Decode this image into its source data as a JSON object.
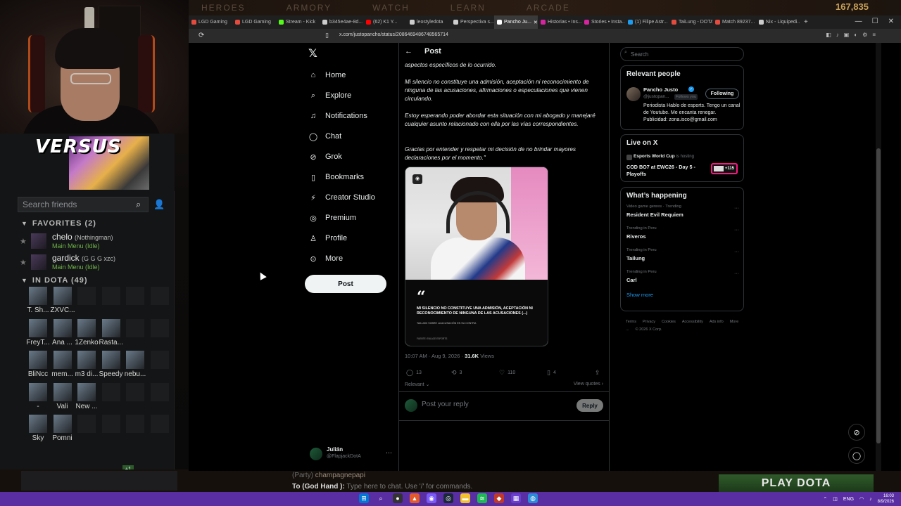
{
  "game": {
    "top_menu": [
      "HEROES",
      "ARMORY",
      "WATCH",
      "LEARN",
      "ARCADE"
    ],
    "gold": "167,835",
    "play_button": "PLAY DOTA",
    "party_prefix": "(Party)",
    "party_name": "champagnepapi",
    "chat_to": "To (God Hand ):",
    "chat_placeholder": "Type here to chat. Use '/' for commands."
  },
  "overlay": {
    "brand": "VERSUS"
  },
  "friends": {
    "search_placeholder": "Search friends",
    "favorites_label": "FAVORITES",
    "favorites_count": "(2)",
    "in_dota_label": "IN DOTA",
    "in_dota_count": "(49)",
    "favorites": [
      {
        "name": "chelo",
        "alias": "(Nothingman)",
        "status": "Main Menu (Idle)"
      },
      {
        "name": "gardick",
        "alias": "(G G G xzc)",
        "status": "Main Menu (Idle)"
      }
    ],
    "in_dota_row1": [
      "T. Sh...",
      "ZXVC...",
      "",
      "",
      "",
      ""
    ],
    "in_dota_row2": [
      "FreyT...",
      "Ana ...",
      "1Zenko",
      "Rasta...",
      "",
      ""
    ],
    "in_dota_row3": [
      "BliNcc",
      "mem...",
      "m3 di...",
      "Speedy",
      "nebu...",
      ""
    ],
    "in_dota_row4": [
      "-",
      "Vali",
      "New ...",
      "",
      "",
      ""
    ],
    "in_dota_row5": [
      "Sky",
      "Pomni",
      "",
      "",
      "",
      ""
    ],
    "plus_badge": "+1"
  },
  "browser": {
    "tabs": [
      {
        "label": "LGD Gaming",
        "color": "#e34b3f"
      },
      {
        "label": "LGD Gaming",
        "color": "#e34b3f"
      },
      {
        "label": "Stream - Kick",
        "color": "#53fc18"
      },
      {
        "label": "b345e4ae-8d...",
        "color": "#cccccc"
      },
      {
        "label": "(62) K1 Y...",
        "color": "#ff0000"
      },
      {
        "label": "leostyledota",
        "color": "#cccccc"
      },
      {
        "label": "Perspectiva s...",
        "color": "#cccccc"
      },
      {
        "label": "Pancho Ju...",
        "color": "#ffffff",
        "active": true
      },
      {
        "label": "Historias • Ins...",
        "color": "#d6249f"
      },
      {
        "label": "Stories • Insta...",
        "color": "#d6249f"
      },
      {
        "label": "(1) Filipe Astr...",
        "color": "#1d9bf0"
      },
      {
        "label": "TaiLung - DOTA...",
        "color": "#e34b3f"
      },
      {
        "label": "Match 89237...",
        "color": "#e34b3f"
      },
      {
        "label": "Nix - Liquipedi...",
        "color": "#cccccc"
      }
    ],
    "url": "x.com/justopancho/status/2086469486748565714"
  },
  "x": {
    "nav": [
      {
        "label": "Home",
        "icon": "home-icon",
        "glyph": "⌂"
      },
      {
        "label": "Explore",
        "icon": "search-icon",
        "glyph": "⌕"
      },
      {
        "label": "Notifications",
        "icon": "bell-icon",
        "glyph": "♫"
      },
      {
        "label": "Chat",
        "icon": "chat-icon",
        "glyph": "◯"
      },
      {
        "label": "Grok",
        "icon": "grok-icon",
        "glyph": "⊘"
      },
      {
        "label": "Bookmarks",
        "icon": "bookmark-icon",
        "glyph": "▯"
      },
      {
        "label": "Creator Studio",
        "icon": "creator-studio-icon",
        "glyph": "⚡"
      },
      {
        "label": "Premium",
        "icon": "premium-icon",
        "glyph": "◎"
      },
      {
        "label": "Profile",
        "icon": "profile-icon",
        "glyph": "♙"
      },
      {
        "label": "More",
        "icon": "more-icon",
        "glyph": "⊙"
      }
    ],
    "post_button": "Post",
    "account": {
      "name": "Julián",
      "handle": "@FlapjackDotA"
    },
    "post_header": "Post",
    "post_text": [
      "aspectos específicos de lo ocurrido.",
      "Mi silencio no constituye una admisión, aceptación ni reconocimiento de ninguna de las acusaciones, afirmaciones o especulaciones que vienen circulando.",
      "Estoy esperando poder abordar esta situación con mi abogado y manejaré cualquier asunto relacionado con ella por las vías correspondientes.",
      "Gracias por entender y respetar mi decisión de no brindar mayores declaraciones por el momento.\""
    ],
    "image_quote": "MI SILENCIO NO CONSTITUYE UNA ADMISIÓN, ACEPTACIÓN NI RECONOCIMIENTO DE NINGUNA DE LAS ACUSACIONES (...)",
    "image_caption": "TAILUNG SOBRE LA ACUSACIÓN EN SU CONTRA",
    "image_source": "FUENTE: ENLACE ESPORTS",
    "post_time": "10:07 AM · Aug 9, 2026 ·",
    "views_count": "31.6K",
    "views_label": "Views",
    "actions": {
      "replies": "13",
      "reposts": "3",
      "likes": "110",
      "bookmarks": "4"
    },
    "relevant_label": "Relevant",
    "view_quotes": "View quotes",
    "reply_placeholder": "Post your reply",
    "reply_button": "Reply",
    "search_placeholder": "Search",
    "relevant_people": {
      "title": "Relevant people",
      "name": "Pancho Justo",
      "handle": "@justopan...",
      "follows_you": "Follows you",
      "following_button": "Following",
      "bio": "Periodista Hablo de esports. Tengo un canal de Youtube. Me encanta renegar. Publicidad: zona.isco@gmail.com"
    },
    "live": {
      "title": "Live on X",
      "host": "Esports World Cup",
      "hosting_label": "is hosting",
      "stream_title": "COD BO7 at EWC26 - Day 5 - Playoffs",
      "badge": "+115"
    },
    "happening": {
      "title": "What’s happening",
      "trends": [
        {
          "context": "Video game genres · Trending",
          "name": "Resident Evil Requiem"
        },
        {
          "context": "Trending in Peru",
          "name": "Riveros"
        },
        {
          "context": "Trending in Peru",
          "name": "Tailung"
        },
        {
          "context": "Trending in Peru",
          "name": "Carl"
        }
      ],
      "show_more": "Show more"
    },
    "footer": [
      "Terms",
      "Privacy",
      "Cookies",
      "Accessibility",
      "Ads info",
      "More ...",
      "© 2026 X Corp."
    ]
  },
  "taskbar": {
    "lang": "ENG",
    "time": "16:03",
    "date": "8/9/2026"
  }
}
